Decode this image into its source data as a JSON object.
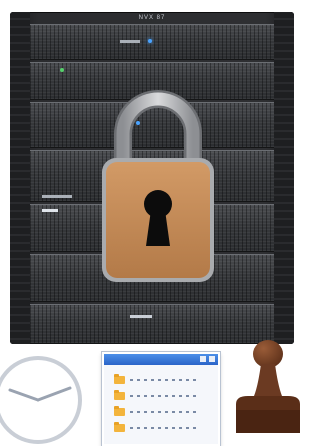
{
  "rack": {
    "brand_text": "NVX 87",
    "colors": {
      "body": "#2e2f32",
      "unit": "#3e4044",
      "led_green": "#55d06b",
      "led_blue": "#4aa3ff"
    }
  },
  "padlock": {
    "icon": "padlock-icon",
    "colors": {
      "shackle": "#bfbfbf",
      "body": "#c08a5a",
      "keyhole": "#0c0c0c"
    }
  },
  "clock": {
    "icon": "clock-icon",
    "colors": {
      "face": "#ffffff",
      "rim": "#c9ced6",
      "hands": "#9aa3b1"
    }
  },
  "file_window": {
    "icon": "file-browser-icon",
    "colors": {
      "titlebar": "#2a64c8",
      "folder": "#f3b43c"
    }
  },
  "stamp": {
    "icon": "rubber-stamp-icon",
    "colors": {
      "handle": "#6b3a22",
      "base": "#5a2e18"
    }
  }
}
